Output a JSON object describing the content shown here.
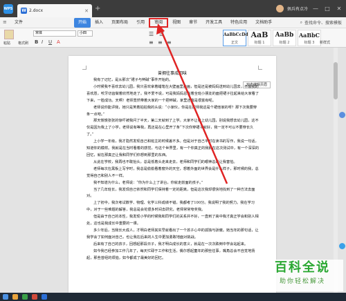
{
  "titlebar": {
    "app": "WPS",
    "doc_name": "2.docx",
    "user": "佩兵有点冷",
    "minimize": "—",
    "maximize": "□",
    "close": "✕",
    "new_tab": "+"
  },
  "menu": {
    "file": "文件",
    "items": [
      "开始",
      "插入",
      "页面布局",
      "引用",
      "审阅",
      "视图",
      "章节",
      "开发工具",
      "特色应用",
      "文档助手"
    ],
    "search": "查找命令、搜索模板"
  },
  "ribbon": {
    "paste": "粘贴",
    "format_painter": "格式刷",
    "font_name": "宋体",
    "font_size": "小四",
    "styles": [
      {
        "sample": "AaBbCcDd",
        "label": "正文"
      },
      {
        "sample": "AaB",
        "label": "标题 1"
      },
      {
        "sample": "AaBb",
        "label": "标题 2"
      },
      {
        "sample": "AaBbC",
        "label": "标题 3"
      }
    ],
    "new_style": "新样式"
  },
  "document": {
    "title": "曾拥往事成回味",
    "float_button": "双击编辑页眉",
    "paragraphs": [
      "我有了记忆，是从那次“裙子与辫碱”事件开始的。",
      "小时候我不喜欢去幼儿园，我只喜欢拿着蜡笔在大壁画里画画，但是还是被妈妈送到幼儿园去，不顺我的喜欢愿，咬牙切齿做着欣然地走了。我不爱不说，可是我妈妈总当着全班小朋友的面把裙子拉起来给大家看了下来，一脸成功。天啊！老师竟然带着大家的一个把辫碱，家里还真是很富有呢。",
      "老师说你能评我，她只是笑着拍拍我的头说：“小家伙，你是在捉师我这是个裙他家的呀？那下次我要穿条一点吧。”",
      "那天慌慌张张的惊吓被我问了半天，第二天就到了上学。大家不让我上幼儿园，别说我想去幼儿园，这不仅是因为我上了小学。老师说有等我，再还是在心里开了条“下次你穿裙子就好，我一定不可以不要穿长久了。”",
      "上小学一年级，我才隐然发现自己和班主的时候差不多。但是对于自己平时在读书的写作，我说一句话，知道你的模样。我就是在当时看着的感觉，与这个世界里，有一个你真正的我就在这次测试中，有一个深深的回忆，就在那真正让我和同学们你想到那里的东西。",
      "从此在学校，我再也不敢抬头，总是低着头走来走去，老师和同学们的眼神总是让我害怕。",
      "老师每次在黑板上写字时，我总是偷偷看着窗外的天空，想着外面的世界会是什么样子，那时候的我，总觉得自己和别人不一样。",
      "我不知道为什么，老师说：“你为什么上了讲台，你就走前面的孩子。”",
      "当了几年班长，我发现自己依然和同学们保持着一定的距离，但是这次我却很快地找到了一种方法去面对。",
      "上了初中，我次考试数学、物理、化学三科成绩不错，我都考了100分。我说明了我的努力。我在学习中，对于一些难题的解答，我总是会花很多时间去研究，老师常常夸奖我。",
      "但是由于自己的本性，我发现小学的时候我和同学们的关系并不好，一直到了高中我才真正学会和别人相处，这也是我成长中重要的一课。",
      "多少年后，当我长大成人，才明白老师其实早就看出了一个孩子心中的孤独与骄傲。她当年的那句话，让我学会了如何面对自己，也让我在后来的人生中更加勇敢地面对挑战。",
      "后来有了自己的孩子，回想起那段日子，我才明白成长的意义，就是在一次次跌倒中学会站起来。",
      "如今我已经参加工作几年了，每天忙碌于工作和生活，偶尔想起童年的那些往事，嘴角总会不自觉地扬起，那些曾经的烦恼，如今都成了最美好的回忆。"
    ]
  },
  "watermark": {
    "title": "百科全说",
    "subtitle": "助你轻松解决"
  },
  "colors": {
    "accent": "#3d85e0",
    "highlight": "#e02424",
    "titlebar": "#3c3c3c"
  }
}
